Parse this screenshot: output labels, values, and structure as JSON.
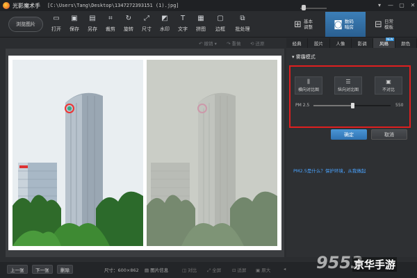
{
  "window": {
    "app_name": "光影魔术手",
    "file_path": "[C:\\Users\\Tang\\Desktop\\1347272393151 (1).jpg]",
    "controls": [
      "▾",
      "—",
      "▢",
      "✕"
    ]
  },
  "toolbar": {
    "browse_label": "浏览图片",
    "tools": [
      {
        "label": "打开",
        "icon": "folder-icon"
      },
      {
        "label": "保存",
        "icon": "save-icon"
      },
      {
        "label": "另存",
        "icon": "save-as-icon"
      },
      {
        "label": "裁剪",
        "icon": "crop-icon"
      },
      {
        "label": "旋转",
        "icon": "rotate-icon"
      },
      {
        "label": "尺寸",
        "icon": "resize-icon"
      },
      {
        "label": "水印",
        "icon": "watermark-icon"
      },
      {
        "label": "文字",
        "icon": "text-icon"
      },
      {
        "label": "拼图",
        "icon": "collage-icon"
      },
      {
        "label": "边框",
        "icon": "border-icon"
      },
      {
        "label": "批处理",
        "icon": "batch-icon"
      }
    ]
  },
  "mode_tabs": [
    {
      "label": "基本调整",
      "icon": "adjust-icon"
    },
    {
      "label": "数码暗房",
      "icon": "camera-icon"
    },
    {
      "label": "日常模板",
      "icon": "template-icon"
    }
  ],
  "edit_bar": {
    "undo": "撤销",
    "redo": "重做",
    "restore": "还原"
  },
  "panel": {
    "tabs": [
      {
        "label": "经典"
      },
      {
        "label": "胶片"
      },
      {
        "label": "人像"
      },
      {
        "label": "影调"
      },
      {
        "label": "风格",
        "badge": "NEW"
      },
      {
        "label": "颜色"
      }
    ],
    "title": "雾霾模式",
    "options": [
      {
        "label": "横向对比图",
        "icon": "⫼"
      },
      {
        "label": "纵向对比图",
        "icon": "☰"
      },
      {
        "label": "不对比",
        "icon": "▣"
      }
    ],
    "slider": {
      "label": "PM 2.5",
      "value": 550,
      "max": 1000,
      "fraction": 0.5
    },
    "ok_label": "确定",
    "cancel_label": "取消",
    "link_text": "PM2.5是什么？保护环境，从我做起"
  },
  "bottom": {
    "prev": "上一张",
    "next": "下一张",
    "delete": "删除",
    "size_text": "尺寸：600×862",
    "info": "图片信息",
    "compare": "对比",
    "fullscreen": "全屏",
    "fit": "适屏",
    "original": "原大"
  },
  "watermark": {
    "num": "9553",
    "text": "京华手游"
  }
}
